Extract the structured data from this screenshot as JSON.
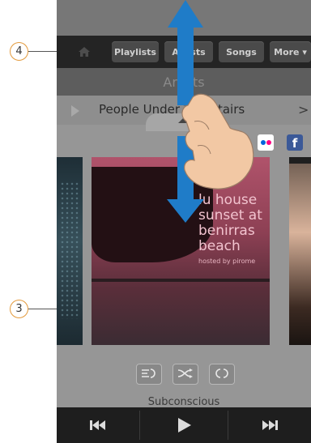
{
  "nav": {
    "items": [
      {
        "label": "Playlists"
      },
      {
        "label": "Artists"
      },
      {
        "label": "Songs"
      },
      {
        "label": "More ▾"
      }
    ]
  },
  "artists_header": {
    "title": "Artists"
  },
  "now_row": {
    "artist": "People Under The Stairs",
    "chevron": ">"
  },
  "cover_main": {
    "title_text": "lu house sunset at benirras beach",
    "small_text": "hosted by pirome"
  },
  "social": {
    "facebook_label": "f"
  },
  "track": {
    "name": "Subconscious"
  },
  "callouts": {
    "three": "3",
    "four": "4"
  },
  "colors": {
    "arrow": "#1f7cc8",
    "callout_border": "#e39a3c",
    "hand": "#f2c8a4"
  },
  "icons": [
    "home-icon",
    "flickr-icon",
    "facebook-icon",
    "repeat-list-icon",
    "shuffle-icon",
    "repeat-icon",
    "previous-icon",
    "play-icon",
    "next-icon",
    "swipe-hand-icon",
    "double-arrow-icon"
  ]
}
